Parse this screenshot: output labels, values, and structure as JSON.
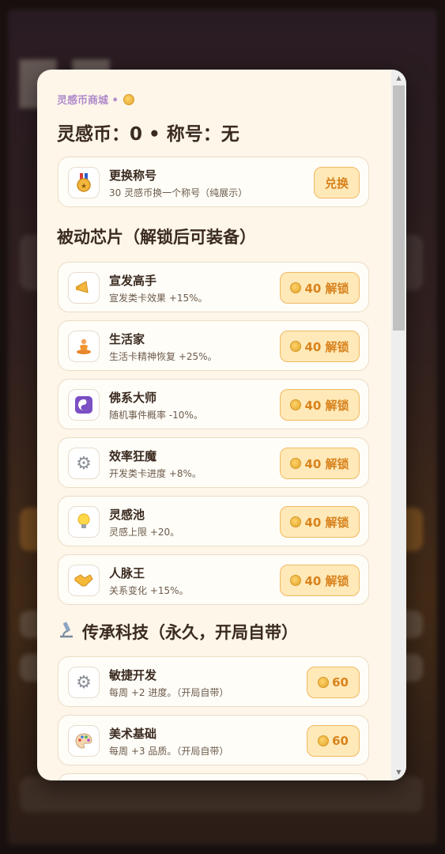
{
  "modal": {
    "eyebrow": "灵感币商城 •",
    "headline": "灵感币：0 • 称号：无"
  },
  "title_card": {
    "title": "更换称号",
    "desc": "30 灵感币换一个称号（纯展示）",
    "button": "兑换",
    "icon": "medal-icon"
  },
  "passive_section": "被动芯片（解锁后可装备）",
  "passive_chips": [
    {
      "title": "宣发高手",
      "desc": "宣发类卡效果 +15%。",
      "button": "40 解锁",
      "icon": "megaphone-icon"
    },
    {
      "title": "生活家",
      "desc": "生活卡精神恢复 +25%。",
      "button": "40 解锁",
      "icon": "meditation-icon"
    },
    {
      "title": "佛系大师",
      "desc": "随机事件概率 -10%。",
      "button": "40 解锁",
      "icon": "yin-yang-icon"
    },
    {
      "title": "效率狂魔",
      "desc": "开发类卡进度 +8%。",
      "button": "40 解锁",
      "icon": "gear-icon"
    },
    {
      "title": "灵感池",
      "desc": "灵感上限 +20。",
      "button": "40 解锁",
      "icon": "lightbulb-icon"
    },
    {
      "title": "人脉王",
      "desc": "关系变化 +15%。",
      "button": "40 解锁",
      "icon": "handshake-icon"
    }
  ],
  "legacy_section": "传承科技（永久，开局自带）",
  "legacy_techs": [
    {
      "title": "敏捷开发",
      "desc": "每周 +2 进度。（开局自带）",
      "button": "60",
      "icon": "gear-icon"
    },
    {
      "title": "美术基础",
      "desc": "每周 +3 品质。（开局自带）",
      "button": "60",
      "icon": "palette-icon"
    }
  ],
  "colors": {
    "modal_bg": "#fdf6e9",
    "accent": "#d8821c",
    "button_bg": "#ffe9b8",
    "eyebrow": "#b08acb"
  }
}
